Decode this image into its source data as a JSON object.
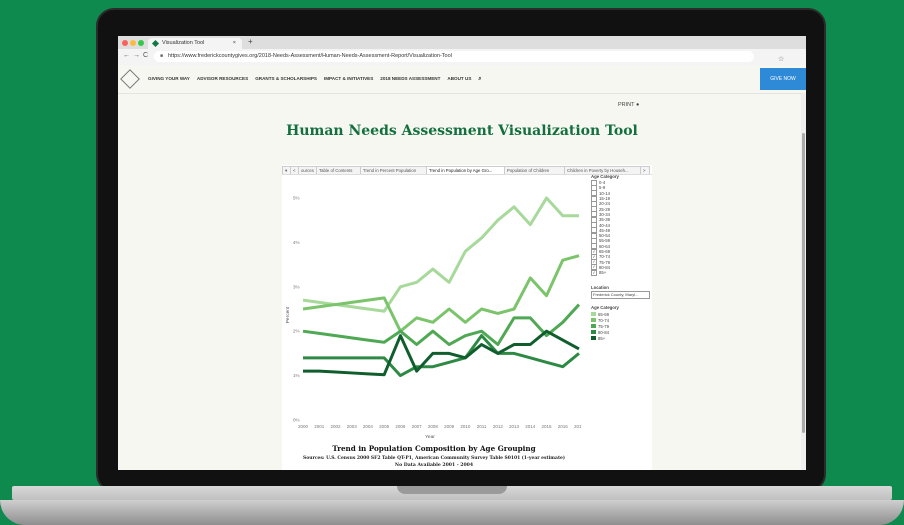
{
  "browser": {
    "tab_title": "Visualization Tool",
    "tab_close": "×",
    "new_tab": "+",
    "url": "https://www.frederickcountygives.org/2018-Needs-Assessment/Human-Needs-Assessment-Report/Visualization-Tool",
    "back": "←",
    "forward": "→",
    "reload": "C",
    "star": "☆"
  },
  "nav": {
    "items": [
      "GIVING YOUR WAY",
      "ADVISOR RESOURCES",
      "GRANTS & SCHOLARSHIPS",
      "IMPACT & INITIATIVES",
      "2018 NEEDS ASSESSMENT",
      "ABOUT US"
    ],
    "search_icon": "⌕",
    "give_now": "GIVE NOW"
  },
  "page": {
    "print_label": "PRINT",
    "print_icon": "●",
    "title": "Human Needs Assessment Visualization Tool"
  },
  "viz_tabs": {
    "scroll_left": "<",
    "scroll_right": ">",
    "menu": "▾",
    "items": [
      "ources",
      "Table of Contents",
      "Trend in Percent Population",
      "Trend in Population by Age Gro...",
      "Population of Children",
      "Children in Poverty by Househ..."
    ],
    "active_index": 3
  },
  "filters": {
    "age_header": "Age Category",
    "age_options": [
      {
        "label": "0-4",
        "checked": false
      },
      {
        "label": "5-9",
        "checked": false
      },
      {
        "label": "10-14",
        "checked": false
      },
      {
        "label": "15-19",
        "checked": false
      },
      {
        "label": "20-24",
        "checked": false
      },
      {
        "label": "25-29",
        "checked": false
      },
      {
        "label": "30-34",
        "checked": false
      },
      {
        "label": "35-39",
        "checked": false
      },
      {
        "label": "40-44",
        "checked": false
      },
      {
        "label": "45-49",
        "checked": false
      },
      {
        "label": "50-54",
        "checked": false
      },
      {
        "label": "55-59",
        "checked": false
      },
      {
        "label": "60-64",
        "checked": false
      },
      {
        "label": "65-69",
        "checked": true
      },
      {
        "label": "70-74",
        "checked": true
      },
      {
        "label": "75-79",
        "checked": true
      },
      {
        "label": "80-84",
        "checked": true
      },
      {
        "label": "85+",
        "checked": true
      }
    ],
    "location_header": "Location",
    "location_value": "Frederick County, Maryl...",
    "legend_header": "Age Category"
  },
  "chart_data": {
    "type": "line",
    "title": "Trend in Population Composition by Age Grouping",
    "subtitle": "Sources: U.S. Census 2000 SF2 Table QT-P1, American Community Survey Table S0101 (1-year estimate)",
    "note": "No Data Available 2001 - 2004",
    "xlabel": "Year",
    "ylabel": "Percent",
    "x": [
      2000,
      2001,
      2002,
      2003,
      2004,
      2005,
      2006,
      2007,
      2008,
      2009,
      2010,
      2011,
      2012,
      2013,
      2014,
      2015,
      2016,
      2017
    ],
    "ylim": [
      0,
      5
    ],
    "yticks": [
      "0%",
      "1%",
      "2%",
      "3%",
      "4%",
      "5%"
    ],
    "grid": false,
    "legend": "right",
    "series": [
      {
        "name": "65-69",
        "color": "#a6d99a",
        "values": [
          2.7,
          2.65,
          2.6,
          2.55,
          2.5,
          2.45,
          3.0,
          3.1,
          3.4,
          3.1,
          3.8,
          4.1,
          4.5,
          4.8,
          4.4,
          5.0,
          4.6,
          4.6
        ]
      },
      {
        "name": "70-74",
        "color": "#7cc46c",
        "values": [
          2.5,
          2.55,
          2.6,
          2.65,
          2.7,
          2.75,
          2.0,
          2.3,
          2.2,
          2.5,
          2.2,
          2.5,
          2.4,
          2.5,
          3.2,
          2.8,
          3.6,
          3.7
        ]
      },
      {
        "name": "75-79",
        "color": "#4fa853",
        "values": [
          2.0,
          1.95,
          1.9,
          1.85,
          1.8,
          1.75,
          2.0,
          1.7,
          2.0,
          1.7,
          1.9,
          2.0,
          1.7,
          2.3,
          2.3,
          1.9,
          2.2,
          2.6
        ]
      },
      {
        "name": "80-84",
        "color": "#2d8a44",
        "values": [
          1.4,
          1.4,
          1.4,
          1.4,
          1.4,
          1.4,
          1.0,
          1.2,
          1.2,
          1.3,
          1.4,
          1.9,
          1.5,
          1.5,
          1.4,
          1.3,
          1.2,
          1.5
        ]
      },
      {
        "name": "85+",
        "color": "#105e2d",
        "values": [
          1.1,
          1.1,
          1.08,
          1.06,
          1.04,
          1.02,
          1.9,
          1.1,
          1.5,
          1.5,
          1.4,
          1.7,
          1.5,
          1.7,
          1.7,
          2.0,
          1.8,
          1.6
        ]
      }
    ]
  }
}
